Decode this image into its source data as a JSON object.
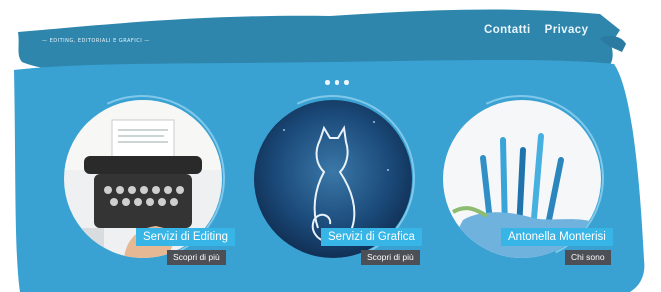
{
  "header": {
    "tagline": "— EDITING, EDITORIALI E GRAFICI —"
  },
  "nav": {
    "items": [
      {
        "label": "Contatti"
      },
      {
        "label": "Privacy"
      }
    ]
  },
  "colors": {
    "banner": "#3aa2d3",
    "accent": "#36b5e6",
    "button": "#4c4f55"
  },
  "cards": [
    {
      "title": "Servizi di Editing",
      "button": "Scopri di più"
    },
    {
      "title": "Servizi di Grafica",
      "button": "Scopri di più"
    },
    {
      "title": "Antonella Monterisi",
      "button": "Chi sono"
    }
  ]
}
